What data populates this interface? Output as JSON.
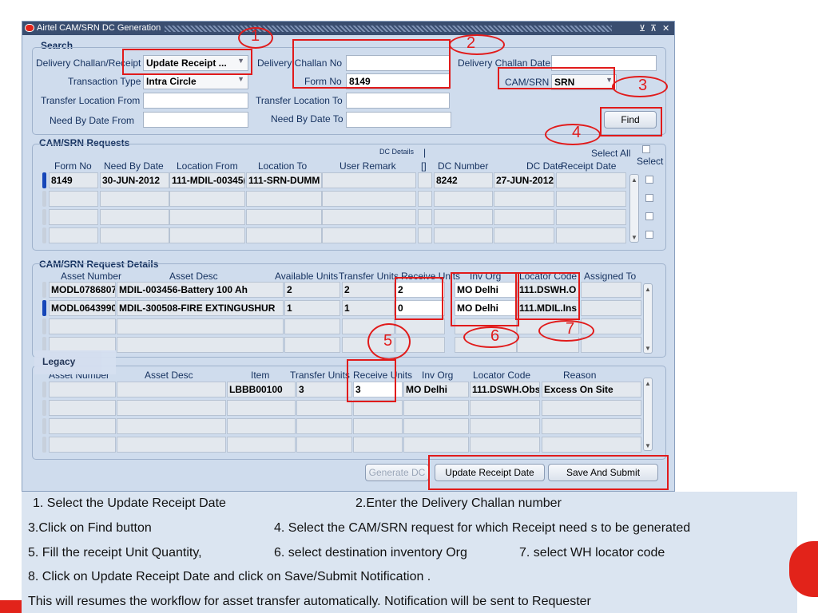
{
  "window": {
    "title": "Airtel CAM/SRN DC Generation",
    "controls": [
      "⊻",
      "⊼",
      "✕"
    ]
  },
  "search": {
    "section_label": "Search",
    "delivery_challan_receipt_label": "Delivery Challan/Receipt",
    "delivery_challan_receipt_value": "Update Receipt ...",
    "delivery_challan_no_label": "Delivery Challan No",
    "delivery_challan_no_value": "",
    "delivery_challan_date_label": "Delivery Challan Date",
    "delivery_challan_date_value": "",
    "transaction_type_label": "Transaction Type",
    "transaction_type_value": "Intra Circle",
    "form_no_label": "Form No",
    "form_no_value": "8149",
    "cam_srn_label": "CAM/SRN",
    "cam_srn_value": "SRN",
    "transfer_location_from_label": "Transfer Location From",
    "transfer_location_to_label": "Transfer Location To",
    "need_by_date_from_label": "Need By Date From",
    "need_by_date_to_label": "Need By Date To",
    "find_label": "Find"
  },
  "requests": {
    "section_label": "CAM/SRN Requests",
    "dc_details_label": "DC Details",
    "select_all_label": "Select All",
    "select_label": "Select",
    "columns": [
      "Form No",
      "Need By Date",
      "Location From",
      "Location To",
      "User Remark",
      "[]",
      "DC Number",
      "DC Date",
      "Receipt Date"
    ],
    "rows": [
      [
        "8149",
        "30-JUN-2012",
        "111-MDIL-00345(",
        "111-SRN-DUMM",
        "",
        "",
        "8242",
        "27-JUN-2012",
        ""
      ],
      [
        "",
        "",
        "",
        "",
        "",
        "",
        "",
        "",
        ""
      ],
      [
        "",
        "",
        "",
        "",
        "",
        "",
        "",
        "",
        ""
      ],
      [
        "",
        "",
        "",
        "",
        "",
        "",
        "",
        "",
        ""
      ]
    ]
  },
  "details": {
    "section_label": "CAM/SRN Request Details",
    "columns": [
      "Asset Number",
      "Asset Desc",
      "Available Units",
      "Transfer Units",
      "Receive Units",
      "Inv Org",
      "Locator Code",
      "Assigned To"
    ],
    "rows": [
      [
        "MODL0786807",
        "MDIL-003456-Battery 100 Ah",
        "2",
        "2",
        "2",
        "MO Delhi",
        "111.DSWH.O",
        ""
      ],
      [
        "MODL0643990",
        "MDIL-300508-FIRE EXTINGUSHUR",
        "1",
        "1",
        "0",
        "MO Delhi",
        "111.MDIL.Ins",
        ""
      ],
      [
        "",
        "",
        "",
        "",
        "",
        "",
        "",
        ""
      ],
      [
        "",
        "",
        "",
        "",
        "",
        "",
        "",
        ""
      ]
    ]
  },
  "legacy": {
    "label": "Legacy",
    "columns": [
      "Asset Number",
      "Asset Desc",
      "Item",
      "Transfer Units",
      "Receive Units",
      "Inv Org",
      "Locator Code",
      "Reason"
    ],
    "rows": [
      [
        "",
        "",
        "LBBB00100",
        "3",
        "3",
        "MO Delhi",
        "111.DSWH.Obs",
        "Excess On Site"
      ],
      [
        "",
        "",
        "",
        "",
        "",
        "",
        "",
        ""
      ],
      [
        "",
        "",
        "",
        "",
        "",
        "",
        "",
        ""
      ],
      [
        "",
        "",
        "",
        "",
        "",
        "",
        "",
        ""
      ]
    ]
  },
  "buttons": {
    "generate_dc": "Generate DC",
    "update_receipt_date": "Update Receipt Date",
    "save_and_submit": "Save And Submit"
  },
  "callouts": [
    "1",
    "2",
    "3",
    "4",
    "5",
    "6",
    "7"
  ],
  "notes": {
    "n1": "1. Select the Update Receipt  Date",
    "n2": "2.Enter the Delivery Challan number",
    "n3": "3.Click  on Find button",
    "n4": "4. Select the CAM/SRN request for which Receipt need s to be generated",
    "n5": "5. Fill the  receipt Unit Quantity,",
    "n6": "6. select destination inventory Org",
    "n7": "7.  select WH locator code",
    "n8": "8. Click on Update Receipt Date and click on Save/Submit Notification .",
    "n9": "This will resumes the workflow for asset transfer automatically. Notification will be sent to  Requester"
  },
  "colors": {
    "annotation": "#e11b1b",
    "window_bg": "#cfdced",
    "titlebar": "#3a4e70",
    "label": "#14305e",
    "notes_bg": "#dbe5f1",
    "brand": "#e2231a"
  }
}
